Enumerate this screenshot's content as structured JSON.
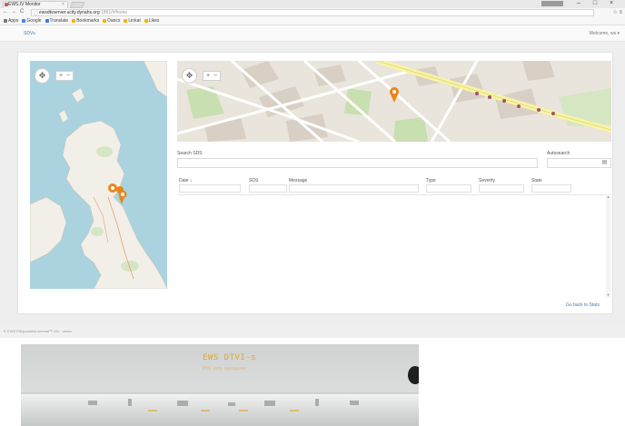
{
  "browser": {
    "tab_title": "EWS.IV Monitor",
    "url_host": "ewsdtvserver.ucity.dynahs.org",
    "url_path": ":1861/#/home",
    "bookmarks": [
      {
        "label": "Apps",
        "color": "#7a7a7a"
      },
      {
        "label": "Google",
        "color": "#4285f4"
      },
      {
        "label": "Translate",
        "color": "#3b78e7"
      },
      {
        "label": "Bookmarks",
        "color": "#f4b400"
      },
      {
        "label": "Dancs",
        "color": "#f4b400"
      },
      {
        "label": "Linkat",
        "color": "#f4b400"
      },
      {
        "label": "Likes",
        "color": "#f4b400"
      }
    ]
  },
  "header": {
    "brand": "SDVs",
    "welcome": "Welcome, ws ▾"
  },
  "search": {
    "label": "Search SDS",
    "autosearch_label": "Autosearch"
  },
  "table": {
    "columns": [
      "Date ↓",
      "SDS",
      "Message",
      "Type",
      "Severity",
      "State"
    ]
  },
  "stats_link": "Go back to Stats",
  "footer": "© EWS Ediquaminis seemaf™ Mo · amnic",
  "device": {
    "brand": "EWS DTVI-s",
    "subtitle": "DTVI data maintainer"
  },
  "colors": {
    "marker": "#e8861c",
    "road_yellow": "#f7f4a3",
    "link": "#4a7aa8",
    "device_text": "#d9a93a"
  }
}
